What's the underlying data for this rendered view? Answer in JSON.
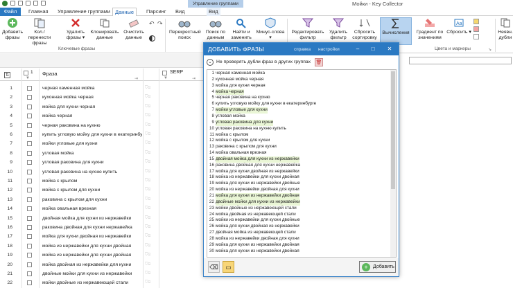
{
  "window": {
    "title": "Мойки - Key Collector",
    "context_tab_header": "Управление группами"
  },
  "tabs": [
    "Файл",
    "Главная",
    "Управление группами",
    "Данные",
    "Парсинг",
    "Вид",
    "Вид"
  ],
  "ribbon": {
    "buttons": [
      {
        "label": "Добавить фразы"
      },
      {
        "label": "Кол./перенести фразы"
      },
      {
        "label": "Удалить фразы ▾"
      },
      {
        "label": "Клонировать данные"
      },
      {
        "label": "Очистить данные"
      },
      {
        "label": "Перекрестный поиск"
      },
      {
        "label": "Поиск по данным"
      },
      {
        "label": "Найти и заменить"
      },
      {
        "label": "Минус-слова ▾"
      },
      {
        "label": "Редактировать фильтр"
      },
      {
        "label": "Удалить фильтр"
      },
      {
        "label": "Сбросить сортировку"
      },
      {
        "label": "Вычисления"
      },
      {
        "label": "Градиент по значениям"
      },
      {
        "label": "Сбросить ▾"
      },
      {
        "label": "Неявн. дубли"
      }
    ],
    "groups": [
      "Ключевые фразы",
      "Цвета и маркеры"
    ]
  },
  "grid": {
    "col_phrase": "Фраза",
    "col_serp": "SERP",
    "header_num": "1",
    "rows": [
      {
        "n": "1",
        "text": "черная каменная мойка"
      },
      {
        "n": "2",
        "text": "кухонная мойка черная"
      },
      {
        "n": "3",
        "text": "мойка для кухни черная"
      },
      {
        "n": "4",
        "text": "мойка черная"
      },
      {
        "n": "5",
        "text": "черная раковина на кухню"
      },
      {
        "n": "6",
        "text": "купить угловую мойку для кухни в екатеринбурге"
      },
      {
        "n": "7",
        "text": "мойки угловые для кухни"
      },
      {
        "n": "8",
        "text": "угловая мойка"
      },
      {
        "n": "9",
        "text": "угловая раковина для кухни"
      },
      {
        "n": "10",
        "text": "угловая раковина на кухню купить"
      },
      {
        "n": "11",
        "text": "мойка с крылом"
      },
      {
        "n": "12",
        "text": "мойка с крылом для кухни"
      },
      {
        "n": "13",
        "text": "раковина с крылом для кухни"
      },
      {
        "n": "14",
        "text": "мойка овальная врезная"
      },
      {
        "n": "15",
        "text": "двойная мойка для кухни из нержавейки"
      },
      {
        "n": "16",
        "text": "раковина двойная для кухни нержавейка"
      },
      {
        "n": "17",
        "text": "мойка для кухни двойная из нержавейки"
      },
      {
        "n": "18",
        "text": "мойка из нержавейки для кухни двойная"
      },
      {
        "n": "19",
        "text": "мойка из нержавейки для кухни двойная"
      },
      {
        "n": "20",
        "text": "мойка двойная из нержавейки для кухни"
      },
      {
        "n": "21",
        "text": "двойные мойки для кухни из нержавейки"
      },
      {
        "n": "22",
        "text": "мойки двойные из нержавеющей стали"
      }
    ]
  },
  "dialog": {
    "title": "ДОБАВИТЬ ФРАЗЫ",
    "link_help": "справка",
    "link_settings": "настройки",
    "option_label": "Не проверять дубли фраз в других группах",
    "add_button": "Добавить",
    "lines": [
      {
        "n": "1",
        "text": "черная каменная мойка"
      },
      {
        "n": "2",
        "text": "кухонная мойка черная"
      },
      {
        "n": "3",
        "text": "мойка для кухни черная"
      },
      {
        "n": "4",
        "text": "мойка черная"
      },
      {
        "n": "5",
        "text": "черная раковина на кухню"
      },
      {
        "n": "6",
        "text": "купить угловую мойку для кухни в екатеринбурге"
      },
      {
        "n": "7",
        "text": "мойки угловые для кухни"
      },
      {
        "n": "8",
        "text": "угловая мойка"
      },
      {
        "n": "9",
        "text": "угловая раковина для кухни"
      },
      {
        "n": "10",
        "text": "угловая раковина на кухню купить"
      },
      {
        "n": "11",
        "text": "мойка с крылом"
      },
      {
        "n": "12",
        "text": "мойка с крылом для кухни"
      },
      {
        "n": "13",
        "text": "раковина с крылом для кухни"
      },
      {
        "n": "14",
        "text": "мойка овальная врезная"
      },
      {
        "n": "15",
        "text": "двойная мойка для кухни из нержавейки"
      },
      {
        "n": "16",
        "text": "раковина двойная для кухни нержавейка"
      },
      {
        "n": "17",
        "text": "мойка для кухни двойная из нержавейки"
      },
      {
        "n": "18",
        "text": "мойка из нержавейки для кухни двойная"
      },
      {
        "n": "19",
        "text": "мойка для кухни из нержавейки двойные"
      },
      {
        "n": "20",
        "text": "мойка из нержавейки двойная для кухни"
      },
      {
        "n": "21",
        "text": "мойка для кухни из нержавейки двойная"
      },
      {
        "n": "22",
        "text": "двойные мойки для кухни из нержавейки"
      },
      {
        "n": "23",
        "text": "мойки двойные из нержавеющей стали"
      },
      {
        "n": "24",
        "text": "мойка двойная из нержавеющей стали"
      },
      {
        "n": "25",
        "text": "мойки из нержавейки для кухни двойные"
      },
      {
        "n": "26",
        "text": "мойка для кухни двойная из нержавейки"
      },
      {
        "n": "27",
        "text": "двойная мойка из нержавеющей стали"
      },
      {
        "n": "28",
        "text": "мойка из нержавейки двойная для кухни"
      },
      {
        "n": "29",
        "text": "мойка для кухни из нержавейки двойная"
      },
      {
        "n": "30",
        "text": "мойка для кухни из нержавейки двойная"
      }
    ]
  },
  "colors": {
    "accent": "#2b79c2",
    "selected": "#b8d4f0"
  }
}
